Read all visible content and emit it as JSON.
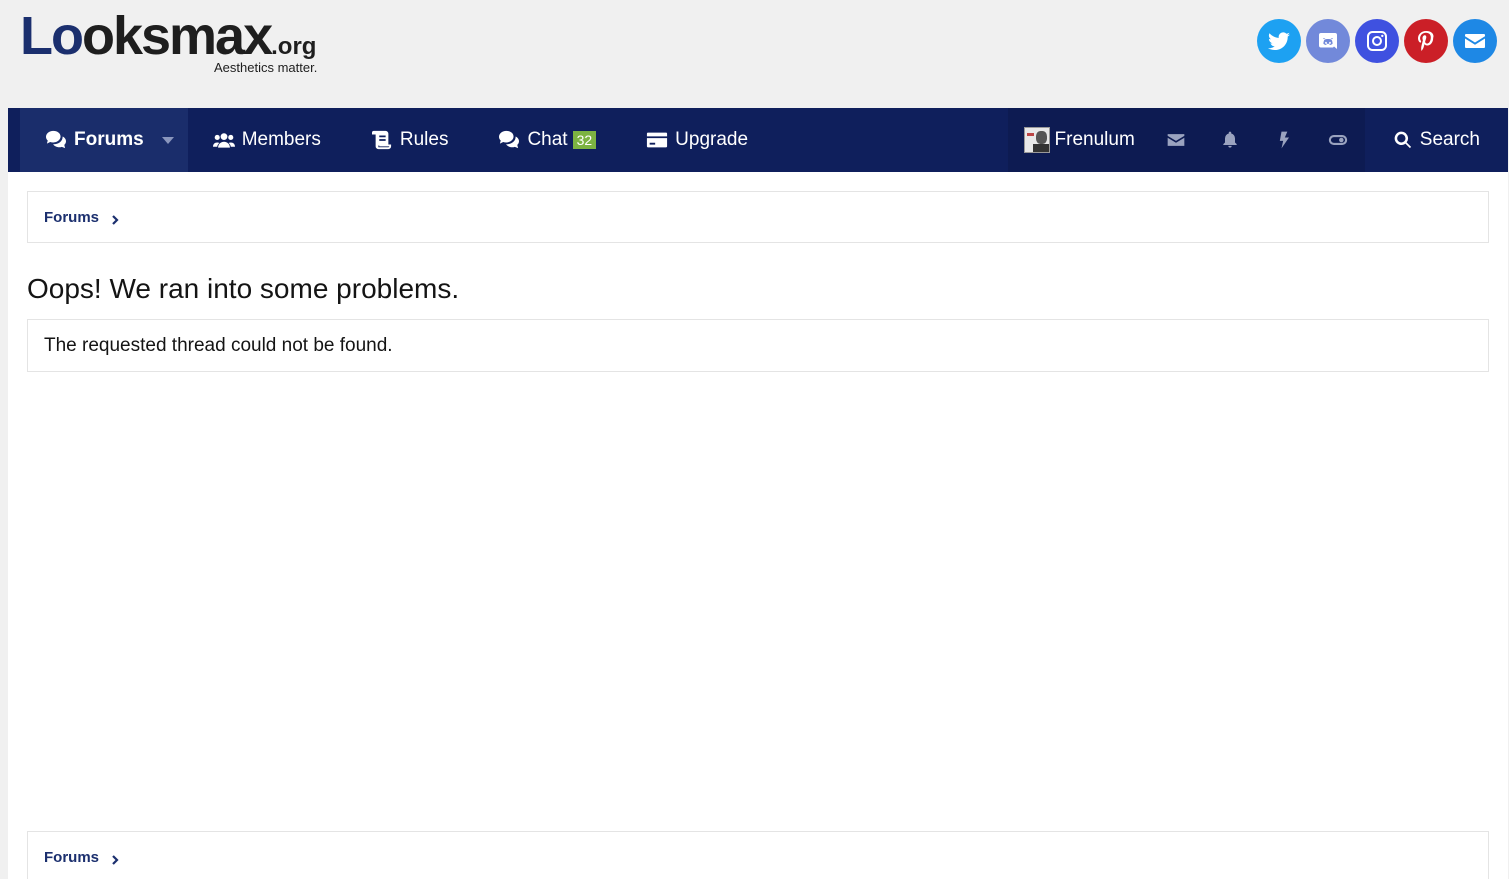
{
  "logo": {
    "part1": "Lo",
    "part2": "oksmax",
    "part3": ".org",
    "tagline": "Aesthetics matter."
  },
  "social": [
    {
      "icon": "twitter-icon",
      "color": "#1da1f2"
    },
    {
      "icon": "discord-icon",
      "color": "#7289da"
    },
    {
      "icon": "instagram-icon",
      "color": "#3f51e0"
    },
    {
      "icon": "pinterest-icon",
      "color": "#cb1f27"
    },
    {
      "icon": "email-icon",
      "color": "#1e88e5"
    }
  ],
  "nav": {
    "forums": "Forums",
    "members": "Members",
    "rules": "Rules",
    "chat": "Chat",
    "chat_count": "32",
    "upgrade": "Upgrade",
    "username": "Frenulum",
    "search": "Search"
  },
  "breadcrumb": {
    "top": "Forums",
    "bottom": "Forums"
  },
  "page": {
    "title": "Oops! We ran into some problems.",
    "message": "The requested thread could not be found."
  },
  "colors": {
    "nav_bg": "#0f1f5c",
    "brand": "#1b2f6e",
    "badge": "#7cb342"
  }
}
